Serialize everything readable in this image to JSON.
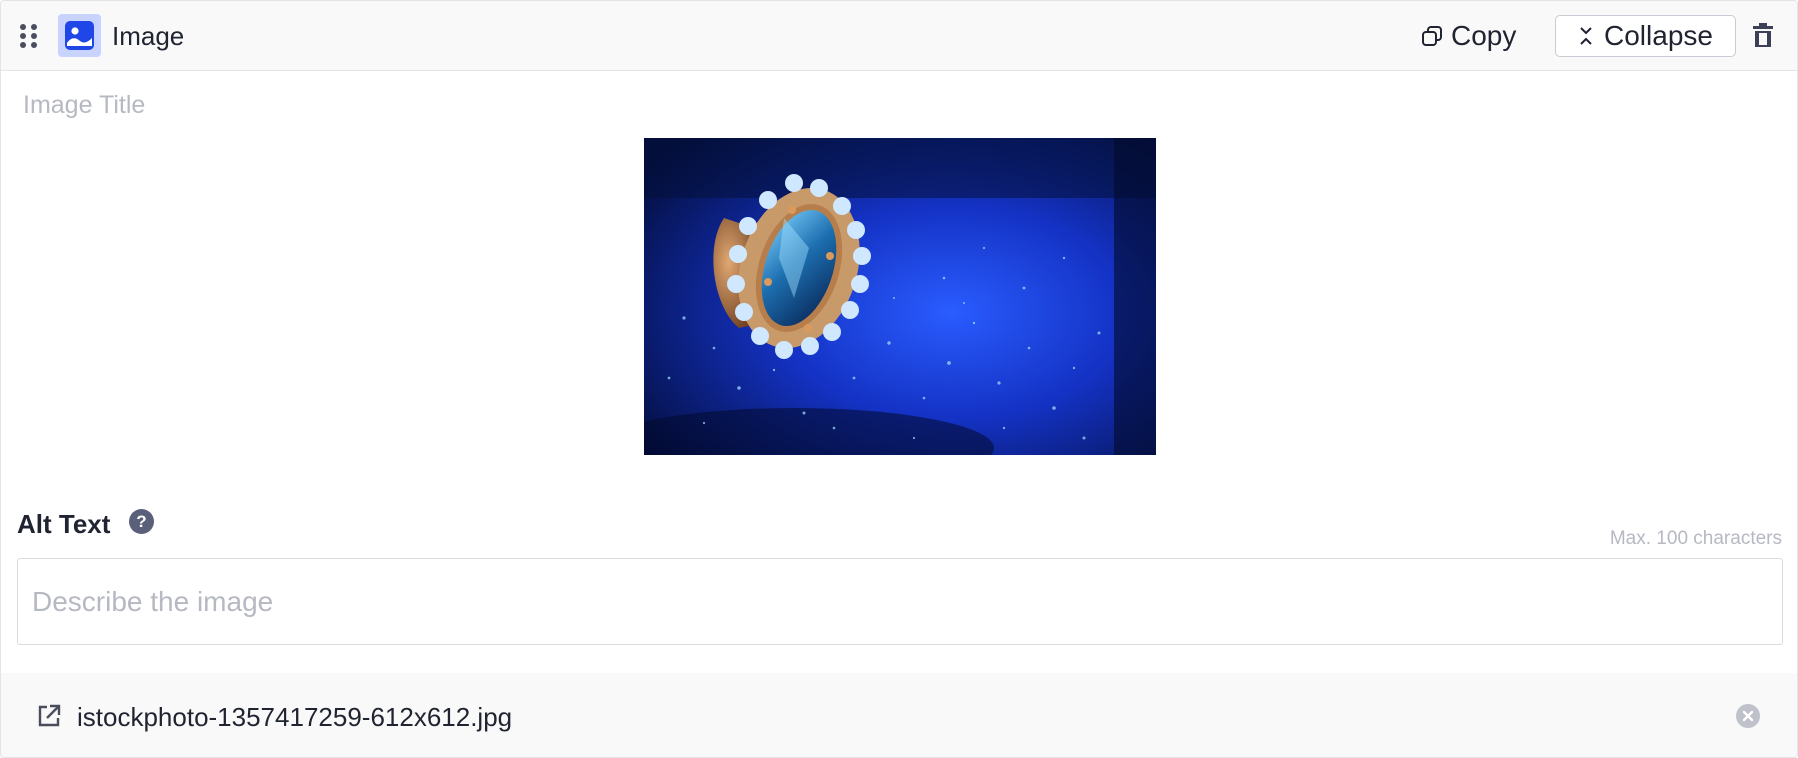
{
  "header": {
    "title": "Image",
    "copy_label": "Copy",
    "collapse_label": "Collapse"
  },
  "icons": {
    "drag": "drag-handle-icon",
    "type": "image-icon",
    "copy": "copy-icon",
    "collapse": "collapse-icon",
    "delete": "trash-icon",
    "help": "help-icon",
    "open": "external-link-icon",
    "remove": "remove-icon"
  },
  "image_block": {
    "title_value": "",
    "title_placeholder": "Image Title",
    "alt_label": "Alt Text",
    "help_glyph": "?",
    "max_chars_hint": "Max. 100 characters",
    "alt_value": "",
    "alt_placeholder": "Describe the image"
  },
  "file": {
    "name": "istockphoto-1357417259-612x612.jpg"
  },
  "colors": {
    "accent": "#1f46e6",
    "icon_bg": "#c9d3ff",
    "header_bg": "#f9f9fa"
  }
}
